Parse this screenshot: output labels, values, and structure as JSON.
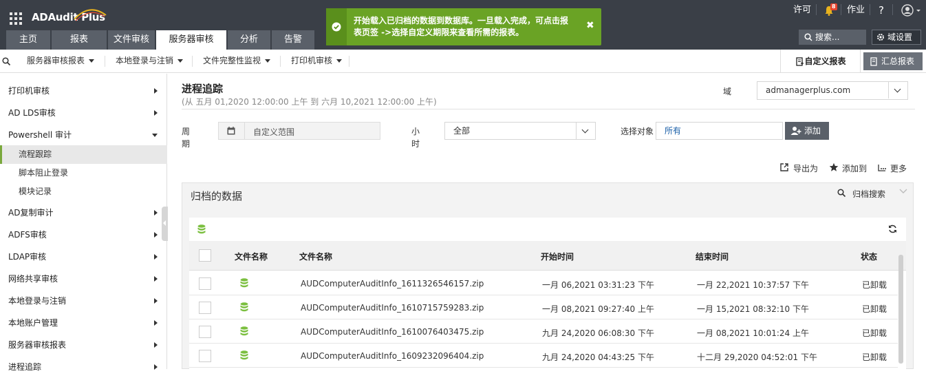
{
  "app": {
    "title": "ADAudit Plus"
  },
  "top_links": {
    "license": "许可",
    "notification_count": "8",
    "jobs": "作业",
    "help": "?"
  },
  "tabs": [
    "主页",
    "报表",
    "文件审核",
    "服务器审核",
    "分析",
    "告警"
  ],
  "search": {
    "label": "搜索..."
  },
  "domain_settings": "域设置",
  "toast": {
    "message": "开始载入已归档的数据到数据库。一旦载入完成，可点击报表页签 ->选择自定义期限来查看所需的报表。"
  },
  "subnav": {
    "items": [
      "服务器审核报表",
      "本地登录与注销",
      "文件完整性监视",
      "打印机审核"
    ],
    "custom_report": "自定义报表",
    "summary_report": "汇总报表"
  },
  "sidebar": {
    "items": [
      "打印机审核",
      "AD LDS审核",
      "Powershell 审计"
    ],
    "subitems": [
      "流程跟踪",
      "脚本阻止登录",
      "模块记录"
    ],
    "items2": [
      "AD复制审计",
      "ADFS审核",
      "LDAP审核",
      "网络共享审核",
      "本地登录与注销",
      "本地账户管理",
      "服务器审核报表",
      "进程追踪"
    ]
  },
  "content": {
    "title": "进程追踪",
    "subtitle": "(从 五月 01,2020 12:00:00 上午 到 六月 10,2021 12:00:00 上午)",
    "domain_label": "域",
    "domain_value": "admanagerplus.com",
    "period_label_1": "周",
    "period_label_2": "期",
    "period_value": "自定义范围",
    "hour_label_1": "小",
    "hour_label_2": "时",
    "hour_value": "全部",
    "target_label": "选择对象",
    "target_value": "所有",
    "add_button": "添加",
    "export": "导出为",
    "add_to": "添加到",
    "more": "更多"
  },
  "archived": {
    "title": "归档的数据",
    "search_label": "归档搜索",
    "columns": [
      "文件名称",
      "文件名称",
      "开始时间",
      "结束时间",
      "状态"
    ],
    "rows": [
      {
        "file": "AUDComputerAuditInfo_1611326546157.zip",
        "start": "一月 06,2021 03:31:23 下午",
        "end": "一月 22,2021 10:37:57 下午",
        "status": "已卸载"
      },
      {
        "file": "AUDComputerAuditInfo_1610715759283.zip",
        "start": "一月 08,2021 09:27:40 上午",
        "end": "一月 15,2021 08:32:10 下午",
        "status": "已卸载"
      },
      {
        "file": "AUDComputerAuditInfo_1610076403475.zip",
        "start": "九月 24,2020 06:08:30 下午",
        "end": "一月 08,2021 10:01:24 上午",
        "status": "已卸载"
      },
      {
        "file": "AUDComputerAuditInfo_1609232096404.zip",
        "start": "九月 24,2020 04:43:25 下午",
        "end": "十二月 29,2020 04:52:01 下午",
        "status": "已卸载"
      }
    ]
  },
  "colors": {
    "topbar": "#3a3f47",
    "toast": "#6aa325",
    "accent_green": "#7aa83c",
    "db_icon": "#7bbf3f"
  }
}
